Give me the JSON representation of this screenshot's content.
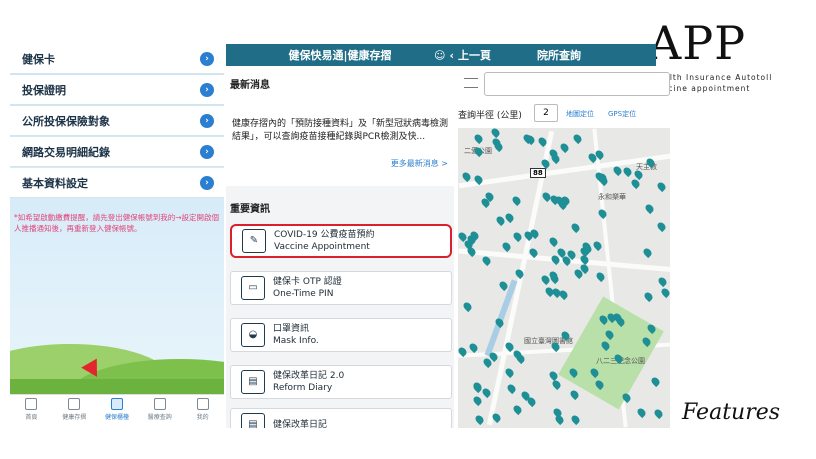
{
  "brand": {
    "title": "APP",
    "subtitle_line1": "Health Insurance Autotoll",
    "subtitle_line2": "Vaccine appointment",
    "features": "Features"
  },
  "left_panel": {
    "menu": [
      "健保卡",
      "投保證明",
      "公所投保保險對象",
      "網路交易明細紀錄",
      "基本資料設定"
    ],
    "notice": "*如希望啟動繳費提醒，請先登出健保帳號到我的→設定開啟個人推播通知後，再重新登入健保帳號。",
    "tabs": [
      "首頁",
      "健康存摺",
      "健保櫃檯",
      "醫療查詢",
      "我的"
    ],
    "active_tab_index": 2
  },
  "middle_panel": {
    "header_title": "健保快易通|健康存摺",
    "latest_news_label": "最新消息",
    "news_text": "健康存摺內的「預防接種資料」及「新型冠狀病毒檢測結果」，可以查詢疫苗接種紀錄與PCR檢測及快...",
    "more_news": "更多最新消息 >",
    "important_label": "重要資訊",
    "items": [
      {
        "zh": "COVID-19 公費疫苗預約",
        "en": "Vaccine Appointment",
        "icon": "vaccine-icon"
      },
      {
        "zh": "健保卡 OTP 認證",
        "en": "One-Time PIN",
        "icon": "card-icon"
      },
      {
        "zh": "口罩資訊",
        "en": "Mask Info.",
        "icon": "mask-icon"
      },
      {
        "zh": "健保改革日記 2.0",
        "en": "Reform Diary",
        "icon": "diary-icon"
      },
      {
        "zh": "健保改革日記",
        "en": "",
        "icon": "diary-icon"
      }
    ]
  },
  "right_panel": {
    "back_label": "上一頁",
    "header_title": "院所查詢",
    "radius_label": "查詢半徑 (公里)",
    "radius_value": "2",
    "map_locate": "地圖定位",
    "gps_locate": "GPS定位",
    "map_labels": [
      "二愛公園",
      "天主教",
      "永和樂華",
      "國立臺灣圖書館",
      "八二三紀念公園"
    ],
    "badge": "88"
  },
  "colors": {
    "header": "#1f6d86",
    "accent": "#2a7fd1",
    "highlight": "#d9202c",
    "pin": "#1f8f96",
    "notice": "#e0457b"
  }
}
